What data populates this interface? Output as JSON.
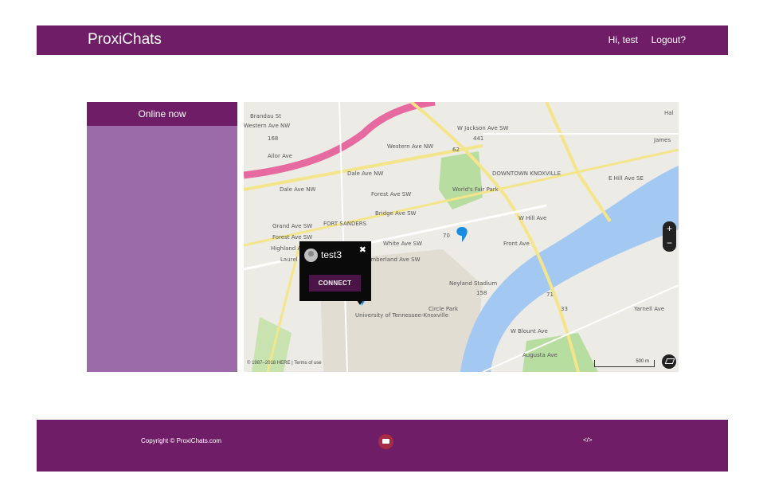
{
  "navbar": {
    "brand": "ProxiChats",
    "greeting": "Hi, test",
    "logout": "Logout?"
  },
  "sidebar": {
    "title": "Online now"
  },
  "map": {
    "labels": {
      "brandau": "Brandau St",
      "western_ave_1": "Western Ave NW",
      "western_ave_2": "Western Ave NW",
      "ailor": "Ailor Ave",
      "dale_ave_1": "Dale Ave NW",
      "dale_ave_2": "Dale Ave NW",
      "forest_ave_1": "Forest Ave SW",
      "forest_ave_2": "Forest Ave SW",
      "grand_ave": "Grand Ave SW",
      "highland": "Highland Ave",
      "laurel": "Laurel Av",
      "bridge_ave": "Bridge Ave SW",
      "white_ave": "White Ave SW",
      "cumberland": "Cumberland Ave SW",
      "fort_sanders": "FORT SANDERS",
      "downtown": "DOWNTOWN KNOXVILLE",
      "worlds_fair": "World's Fair Park",
      "neyland": "Neyland Stadium",
      "utk": "University of Tennessee-Knoxville",
      "circle_park": "Circle Park",
      "hill_ave": "W Hill Ave",
      "e_hill_ave": "E Hill Ave SE",
      "front_ave": "Front Ave",
      "blount": "W Blount Ave",
      "augusta": "Augusta Ave",
      "yarnell": "Yarnell Ave",
      "james": "James",
      "jackson": "W Jackson Ave SW",
      "hall": "Hal",
      "r_70": "70",
      "r_158": "158",
      "r_62": "62",
      "r_441": "441",
      "r_71": "71",
      "r_33": "33",
      "r_168": "168"
    },
    "attribution": "© 1987–2018 HERE | Terms of use",
    "scale_label": "500 m",
    "colors": {
      "land": "#ecebe6",
      "water": "#a3c8f2",
      "highway": "#e66aa0",
      "major_road": "#f4e58a",
      "park": "#b8dda0"
    }
  },
  "popup": {
    "user_name": "test3",
    "close_symbol": "✖",
    "connect_label": "CONNECT"
  },
  "zoom": {
    "in_label": "+",
    "out_label": "−"
  },
  "footer": {
    "copyright": "Copyright © ProxiChats.com",
    "code_symbol": "</>"
  }
}
